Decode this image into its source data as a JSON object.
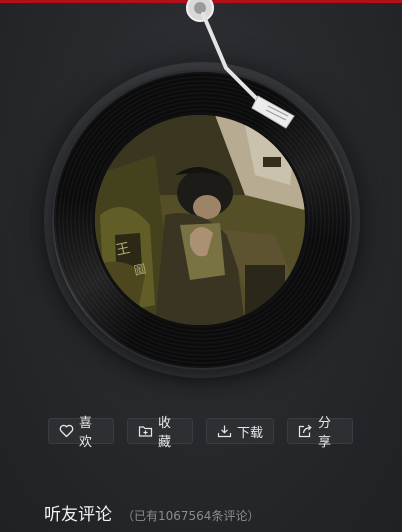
{
  "player": {
    "top_bar_color": "#b0101a",
    "record_icon": "vinyl-record",
    "tonearm_icon": "tonearm",
    "cover_art": "album-cover-image"
  },
  "actions": {
    "like_label": "喜欢",
    "like_icon": "heart-icon",
    "collect_label": "收藏",
    "collect_icon": "folder-plus-icon",
    "download_label": "下载",
    "download_icon": "download-icon",
    "share_label": "分享",
    "share_icon": "share-icon"
  },
  "comments": {
    "title": "听友评论",
    "count_text": "（已有1067564条评论）"
  }
}
